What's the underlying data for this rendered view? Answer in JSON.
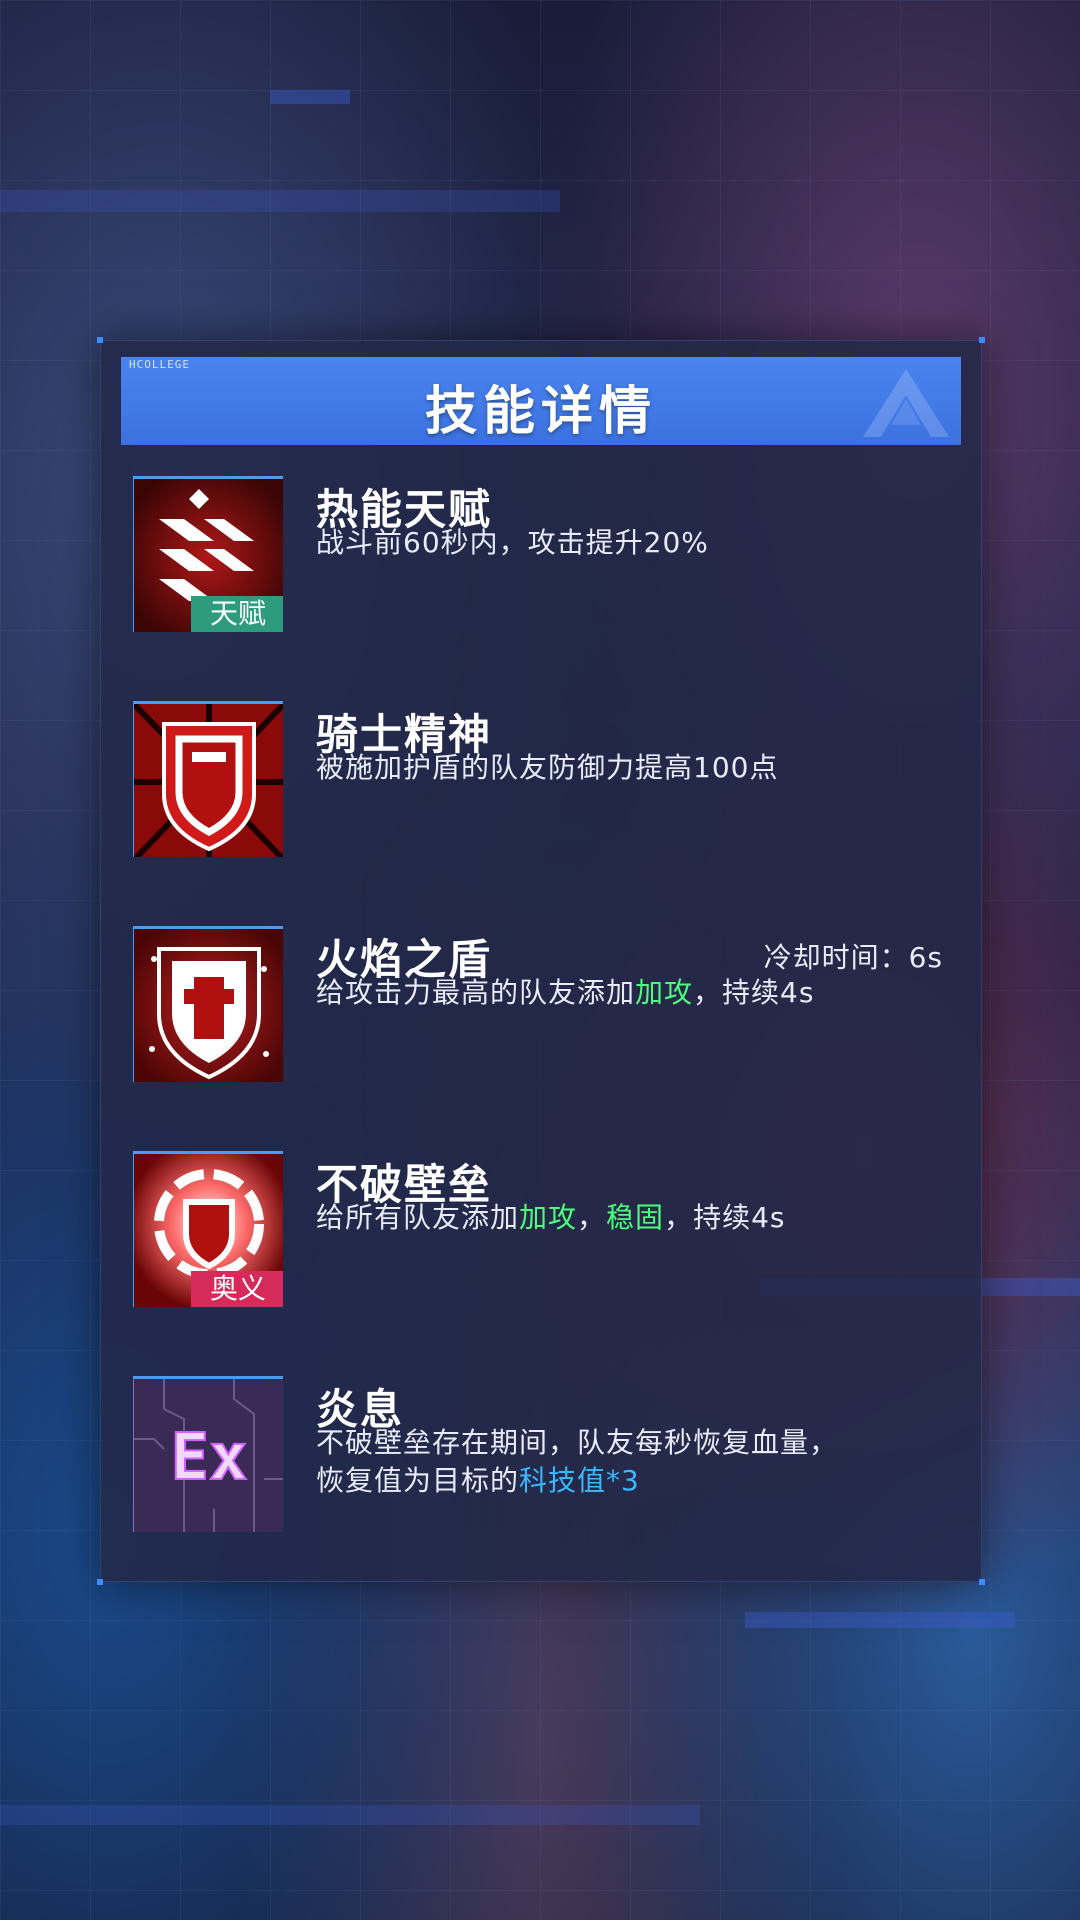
{
  "panel": {
    "header_tag": "HCOLLEGE",
    "title": "技能详情"
  },
  "skills": [
    {
      "name": "热能天赋",
      "desc": "战斗前60秒内，攻击提升20%",
      "badge": "天赋",
      "icon": "heat-stripes-icon"
    },
    {
      "name": "骑士精神",
      "desc": "被施加护盾的队友防御力提高100点",
      "icon": "shield-burst-icon"
    },
    {
      "name": "火焰之盾",
      "cooldown": "冷却时间：6s",
      "desc_parts": [
        "给攻击力最高的队友添加",
        "加攻",
        "，持续4s"
      ],
      "icon": "flame-shield-icon"
    },
    {
      "name": "不破壁垒",
      "desc_parts": [
        "给所有队友添加",
        "加攻",
        "，",
        "稳固",
        "，持续4s"
      ],
      "badge": "奥义",
      "icon": "fortress-shield-icon"
    },
    {
      "name": "炎息",
      "desc_line1": "不破壁垒存在期间，队友每秒恢复血量，",
      "desc_line2_parts": [
        "恢复值为目标的",
        "科技值*3"
      ],
      "icon_text": "Ex",
      "icon": "ex-circuit-icon"
    }
  ],
  "colors": {
    "header_blue": "#4a84f0",
    "highlight_green": "#4cff7a",
    "highlight_blue": "#3ab8ff",
    "badge_talent": "#2e9b7e",
    "badge_ultimate": "#d62a5a"
  }
}
